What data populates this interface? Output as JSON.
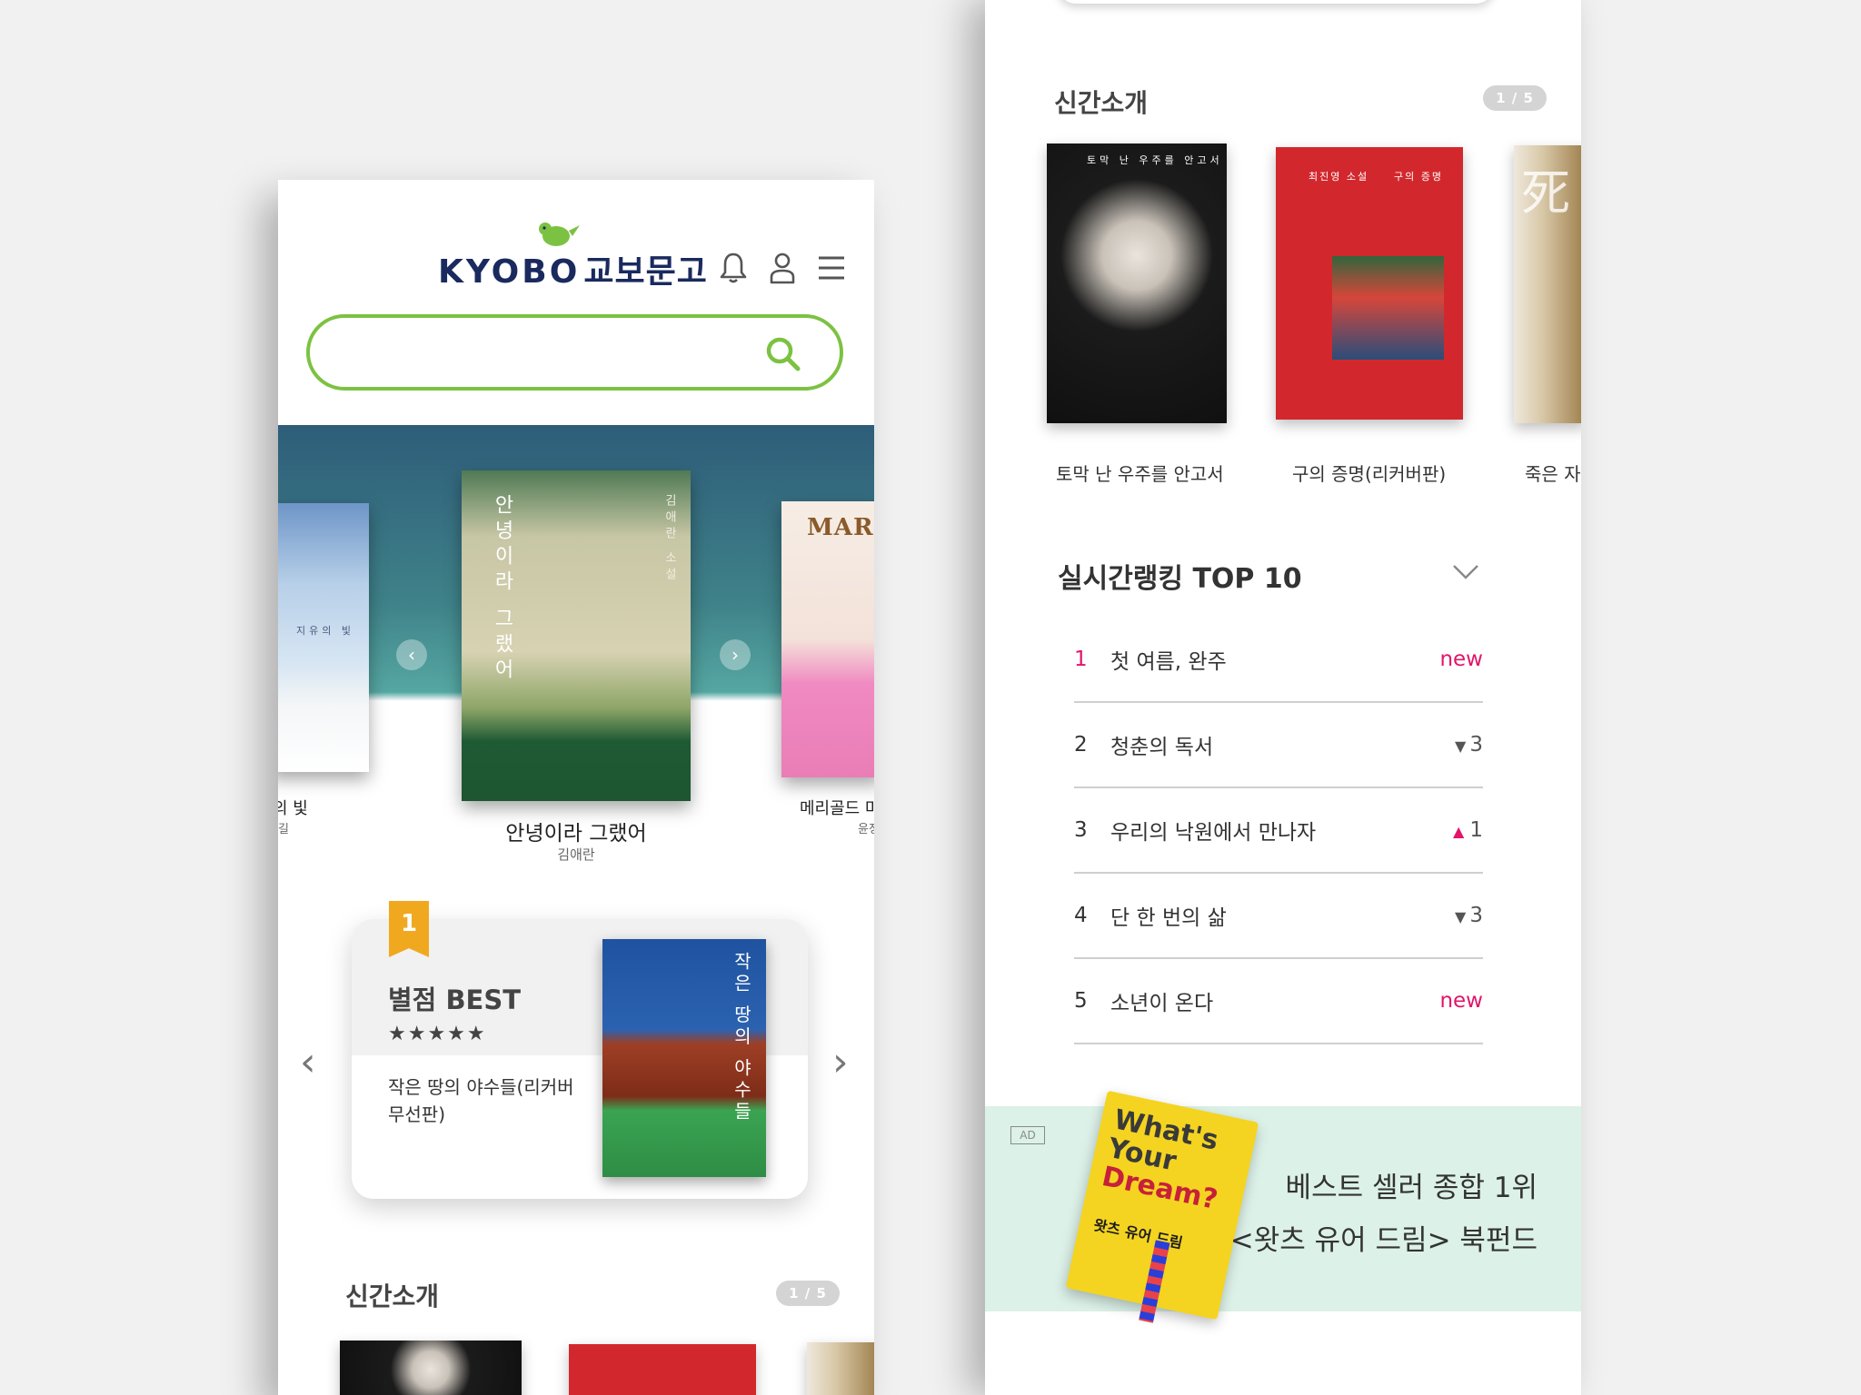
{
  "left": {
    "logo": {
      "en": "KYOBO",
      "ko": "교보문고"
    },
    "search": {
      "placeholder": ""
    },
    "hero": {
      "left_book": {
        "cover_text": "지유의 빛",
        "caption_title": "의 빛",
        "caption_sub": "길"
      },
      "center_book": {
        "cover_title": "안녕이라 그랬어",
        "cover_author": "김애란 소설",
        "caption_title": "안녕이라 그랬어",
        "caption_author": "김애란"
      },
      "right_book": {
        "cover_text": "MARIGOLD",
        "caption_title": "메리골드 마",
        "caption_sub": "윤정"
      },
      "prev_icon": "‹",
      "next_icon": "›"
    },
    "best": {
      "rank": "1",
      "title": "별점 BEST",
      "stars": "★★★★★",
      "book_name": "작은 땅의 야수들(리커버 무선판)",
      "cover_title": "작은 땅의 야수들",
      "prev": "‹",
      "next": "›"
    },
    "new_books": {
      "title": "신간소개",
      "pager": "1 / 5"
    }
  },
  "right": {
    "new_books": {
      "title": "신간소개",
      "pager": "1 / 5",
      "items": [
        {
          "title": "토막 난 우주를 안고서",
          "cover_text": "토막 난 우주를 안고서"
        },
        {
          "title": "구의 증명(리커버판)",
          "cover_text": "구의 증명",
          "cover_author": "최진영 소설"
        },
        {
          "title": "죽은 자",
          "cover_text": "死"
        }
      ]
    },
    "ranking": {
      "title": "실시간랭킹 TOP 10",
      "rows": [
        {
          "rank": "1",
          "title": "첫 여름, 완주",
          "change": "new",
          "dir": "new"
        },
        {
          "rank": "2",
          "title": "청춘의 독서",
          "change": "3",
          "dir": "down"
        },
        {
          "rank": "3",
          "title": "우리의 낙원에서 만나자",
          "change": "1",
          "dir": "up"
        },
        {
          "rank": "4",
          "title": "단 한 번의 삶",
          "change": "3",
          "dir": "down"
        },
        {
          "rank": "5",
          "title": "소년이 온다",
          "change": "new",
          "dir": "new"
        }
      ]
    },
    "ad": {
      "tag": "AD",
      "book_title_1": "What's",
      "book_title_2": "Your",
      "book_title_3": "Dream?",
      "book_ko": "왓츠 유어 드림",
      "line1": "베스트 셀러 종합 1위",
      "line2": "<왓츠 유어 드림> 북펀드"
    }
  },
  "colors": {
    "brand_green": "#7cc242",
    "brand_navy": "#1a2a5e",
    "accent_pink": "#e2156a",
    "best_flag": "#f0a91f"
  }
}
